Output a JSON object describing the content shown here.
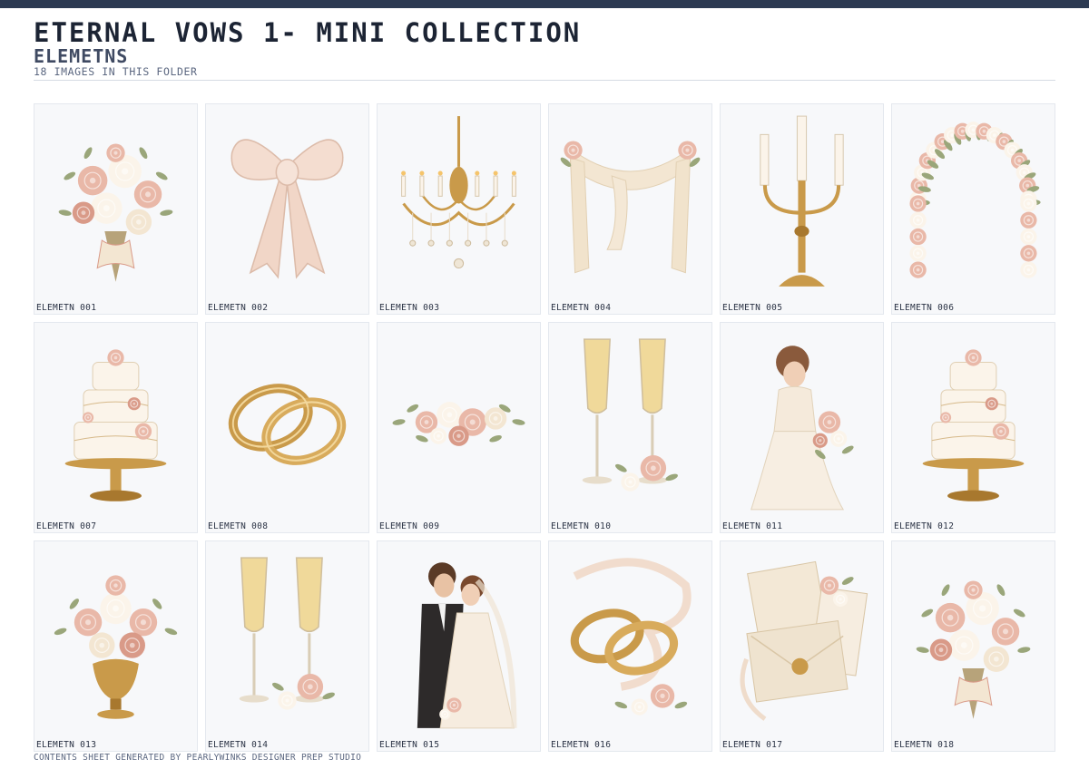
{
  "header": {
    "title": "ETERNAL VOWS 1- MINI COLLECTION",
    "subtitle": "ELEMETNS",
    "count": "18 IMAGES IN THIS FOLDER"
  },
  "colors": {
    "top_bar": "#2c3a52",
    "title": "#1c2434",
    "subtitle": "#3f4a62",
    "tile_background": "#f7f8fa",
    "gold": "#c99a4a",
    "blush": "#e9b8a8",
    "ivory": "#f3e6d2"
  },
  "tiles": [
    {
      "label": "ELEMETN 001",
      "icon": "bouquet-icon"
    },
    {
      "label": "ELEMETN 002",
      "icon": "bow-icon"
    },
    {
      "label": "ELEMETN 003",
      "icon": "chandelier-icon"
    },
    {
      "label": "ELEMETN 004",
      "icon": "drape-icon"
    },
    {
      "label": "ELEMETN 005",
      "icon": "candelabra-icon"
    },
    {
      "label": "ELEMETN 006",
      "icon": "floral-arch-icon"
    },
    {
      "label": "ELEMETN 007",
      "icon": "wedding-cake-icon"
    },
    {
      "label": "ELEMETN 008",
      "icon": "rings-icon"
    },
    {
      "label": "ELEMETN 009",
      "icon": "floral-spray-icon"
    },
    {
      "label": "ELEMETN 010",
      "icon": "champagne-icon"
    },
    {
      "label": "ELEMETN 011",
      "icon": "bride-icon"
    },
    {
      "label": "ELEMETN 012",
      "icon": "wedding-cake-icon"
    },
    {
      "label": "ELEMETN 013",
      "icon": "floral-vase-icon"
    },
    {
      "label": "ELEMETN 014",
      "icon": "champagne-icon"
    },
    {
      "label": "ELEMETN 015",
      "icon": "couple-icon"
    },
    {
      "label": "ELEMETN 016",
      "icon": "rings-ribbon-icon"
    },
    {
      "label": "ELEMETN 017",
      "icon": "invitation-icon"
    },
    {
      "label": "ELEMETN 018",
      "icon": "bouquet-icon"
    }
  ],
  "footer": {
    "text": "CONTENTS SHEET GENERATED BY PEARLYWINKS DESIGNER PREP STUDIO"
  }
}
